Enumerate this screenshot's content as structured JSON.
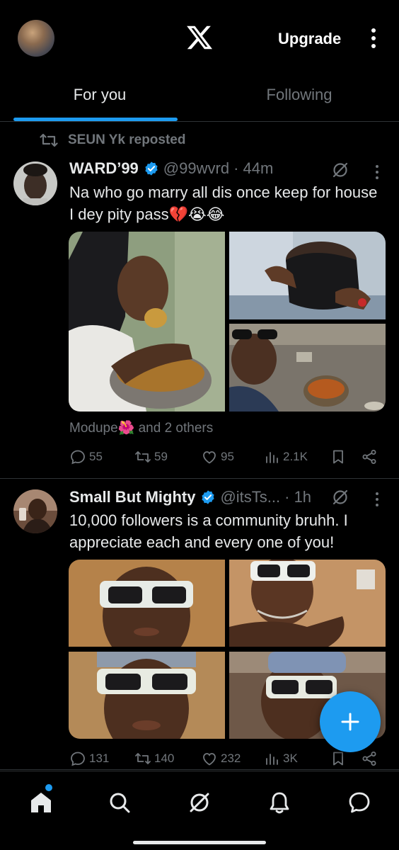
{
  "header": {
    "upgrade_label": "Upgrade"
  },
  "tabs": [
    {
      "label": "For you",
      "active": true
    },
    {
      "label": "Following",
      "active": false
    }
  ],
  "posts": [
    {
      "repost_by": "SEUN Yk reposted",
      "name": "WARD’99",
      "handle": "@99wvrd",
      "time": "· 44m",
      "text": "Na who go marry all dis once keep for house I dey pity pass💔😭😂",
      "liked_by": "Modupe🌺 and 2 others",
      "stats": {
        "replies": "55",
        "reposts": "59",
        "likes": "95",
        "views": "2.1K"
      }
    },
    {
      "name": "Small But Mighty",
      "handle": "@itsTs...",
      "time": "· 1h",
      "text": "10,000 followers is a community bruhh. I appreciate each and every one of you!",
      "stats": {
        "replies": "131",
        "reposts": "140",
        "likes": "232",
        "views": "3K"
      }
    }
  ],
  "colors": {
    "accent": "#1d9bf0",
    "muted": "#71767b",
    "background": "#000000",
    "divider": "#2f3336"
  },
  "icons": {
    "fab": "plus-icon",
    "nav": [
      "home-icon",
      "search-icon",
      "grok-icon",
      "notifications-icon",
      "messages-icon"
    ]
  }
}
